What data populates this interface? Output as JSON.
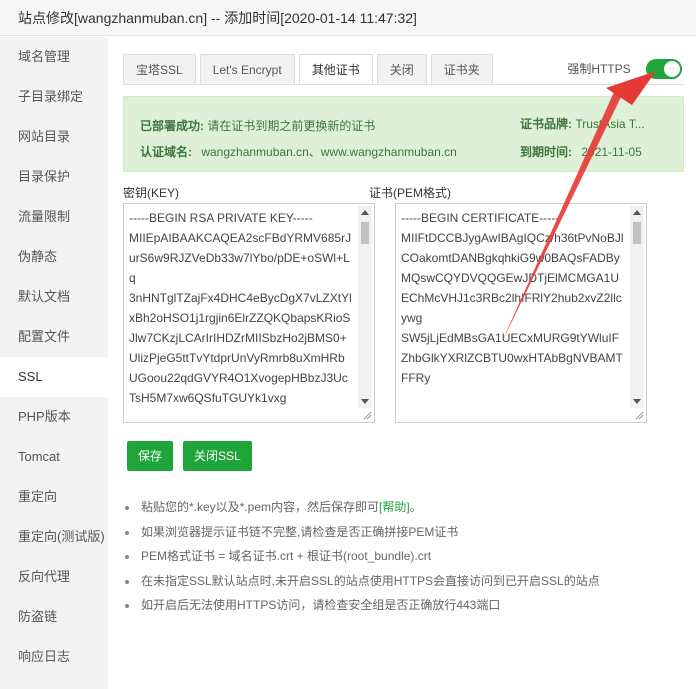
{
  "window": {
    "title": "站点修改[wangzhanmuban.cn] -- 添加时间[2020-01-14 11:47:32]"
  },
  "sidebar": {
    "items": [
      {
        "label": "域名管理"
      },
      {
        "label": "子目录绑定"
      },
      {
        "label": "网站目录"
      },
      {
        "label": "目录保护"
      },
      {
        "label": "流量限制"
      },
      {
        "label": "伪静态"
      },
      {
        "label": "默认文档"
      },
      {
        "label": "配置文件"
      },
      {
        "label": "SSL"
      },
      {
        "label": "PHP版本"
      },
      {
        "label": "Tomcat"
      },
      {
        "label": "重定向"
      },
      {
        "label": "重定向(测试版)"
      },
      {
        "label": "反向代理"
      },
      {
        "label": "防盗链"
      },
      {
        "label": "响应日志"
      }
    ],
    "active": "SSL"
  },
  "tabs": [
    {
      "label": "宝塔SSL"
    },
    {
      "label": "Let's Encrypt"
    },
    {
      "label": "其他证书"
    },
    {
      "label": "关闭"
    },
    {
      "label": "证书夹"
    }
  ],
  "active_tab": "其他证书",
  "force_https": {
    "label": "强制HTTPS",
    "enabled": true,
    "color": "#20a53a"
  },
  "info": {
    "deploy_label": "已部署成功:",
    "deploy_text": "请在证书到期之前更换新的证书",
    "brand_label": "证书品牌:",
    "brand_value": "TrustAsia T...",
    "domain_label": "认证域名:",
    "domain_value": "wangzhanmuban.cn、www.wangzhanmuban.cn",
    "expire_label": "到期时间:",
    "expire_value": "2021-11-05"
  },
  "key_field": {
    "label": "密钥(KEY)",
    "value": "-----BEGIN RSA PRIVATE KEY-----\nMIIEpAIBAAKCAQEA2scFBdYRMV685rJurS6w9RJZVeDb33w7lYbo/pDE+oSWl+Lq\n3nHNTglTZajFx4DHC4eBycDgX7vLZXtYlxBh2oHSO1j1rgjin6ElrZZQKQbapsKRioSJlw7CKzjLCArIrIHDZrMIISbzHo2jBMS0+UlizPjeG5ttTvYtdprUnVyRmrb8uXmHRbUGoou22qdGVYR4O1XvogepHBbzJ3UcTsH5M7xw6QSfuTGUYk1vxg"
  },
  "cert_field": {
    "label": "证书(PEM格式)",
    "value": "-----BEGIN CERTIFICATE-----\nMIIFtDCCBJygAwIBAgIQCz/h36tPvNoBJlCOakomtDANBgkqhkiG9w0BAQsFADBy\nMQswCQYDVQQGEwJDTjElMCMGA1UEChMcVHJ1c3RBc2lhIFRlY2hub2xvZ2llcywg\nSW5jLjEdMBsGA1UECxMURG9tYWluIFZhbGlkYXRlZCBTU0wxHTAbBgNVBAMTFFRy"
  },
  "buttons": {
    "save": "保存",
    "close_ssl": "关闭SSL"
  },
  "tips": [
    {
      "text": "粘贴您的*.key以及*.pem内容，然后保存即可",
      "link": "[帮助]",
      "suffix": "。"
    },
    {
      "text": "如果浏览器提示证书链不完整,请检查是否正确拼接PEM证书"
    },
    {
      "text": "PEM格式证书 = 域名证书.crt + 根证书(root_bundle).crt"
    },
    {
      "text": "在未指定SSL默认站点时,未开启SSL的站点使用HTTPS会直接访问到已开启SSL的站点"
    },
    {
      "text": "如开启后无法使用HTTPS访问，请检查安全组是否正确放行443端口"
    }
  ]
}
